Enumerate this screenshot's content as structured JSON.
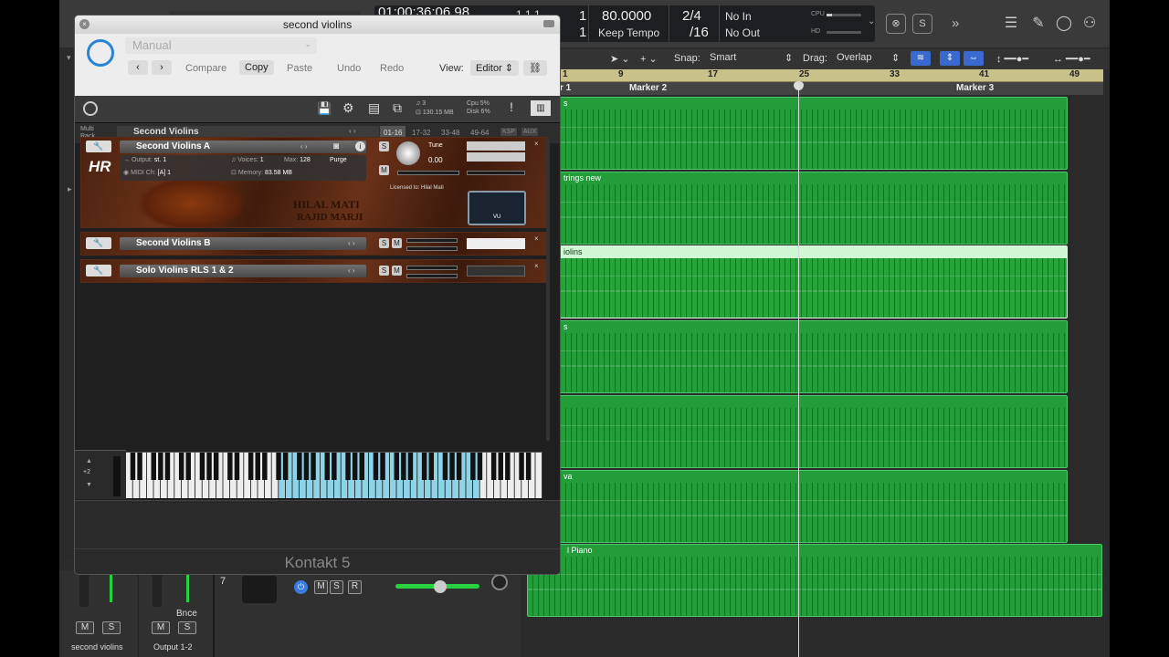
{
  "lcd": {
    "position": "01:00:36:06.98",
    "bars": "1  1  1",
    "beat_top": "1",
    "beat_bottom": "1",
    "tempo": "80.0000",
    "tempo_mode": "Keep Tempo",
    "signature_top": "2/4",
    "signature_bottom": "/16",
    "in": "No In",
    "out": "No Out",
    "cpu_label": "CPU",
    "hd_label": "HD"
  },
  "editbar": {
    "snap_label": "Snap:",
    "snap_value": "Smart",
    "drag_label": "Drag:",
    "drag_value": "Overlap"
  },
  "ruler": {
    "bars": [
      "9",
      "17",
      "25",
      "33",
      "41",
      "49"
    ],
    "first": "1"
  },
  "markers": [
    "r 1",
    "Marker 2",
    "Marker 3"
  ],
  "regions": [
    {
      "name": "s"
    },
    {
      "name": "trings new"
    },
    {
      "name": "iolins"
    },
    {
      "name": "s"
    },
    {
      "name": ""
    },
    {
      "name": "va"
    },
    {
      "name": "l Piano"
    }
  ],
  "mixer": {
    "track_number": "7",
    "m": "M",
    "s": "S",
    "r": "R",
    "bnce": "Bnce",
    "channel1": "second violins",
    "channel2": "Output 1-2"
  },
  "kontakt": {
    "window_title": "second violins",
    "preset": "Manual",
    "compare": "Compare",
    "copy": "Copy",
    "paste": "Paste",
    "undo": "Undo",
    "redo": "Redo",
    "view_label": "View:",
    "view_value": "Editor",
    "voices_info": "3",
    "mem_info": "130.15 MB",
    "cpu_info": "Cpu  5%",
    "disk_info": "Disk  6%",
    "multi_rack": "Multi\nRack",
    "rack_name": "Second Violins",
    "pages": [
      "01-16",
      "17-32",
      "33-48",
      "49-64",
      "KSP",
      "AUX"
    ],
    "instruments": [
      {
        "name": "Second Violins A",
        "output_label": "Output:",
        "output": "st. 1",
        "midi_label": "MIDI Ch:",
        "midi": "[A] 1",
        "voices_label": "Voices:",
        "voices": "1",
        "max_label": "Max:",
        "max": "128",
        "purge": "Purge",
        "memory_label": "Memory:",
        "memory": "83.58 MB",
        "tune_label": "Tune",
        "tune": "0.00",
        "licensed": "Licensed to: Hilal Mati",
        "logo_line1": "HILAL MATI",
        "logo_line2": "RAJID MARJI",
        "vu": "VU"
      },
      {
        "name": "Second Violins B"
      },
      {
        "name": "Solo Violins RLS 1 & 2"
      }
    ],
    "octave": "+2",
    "footer": "Kontakt 5"
  }
}
